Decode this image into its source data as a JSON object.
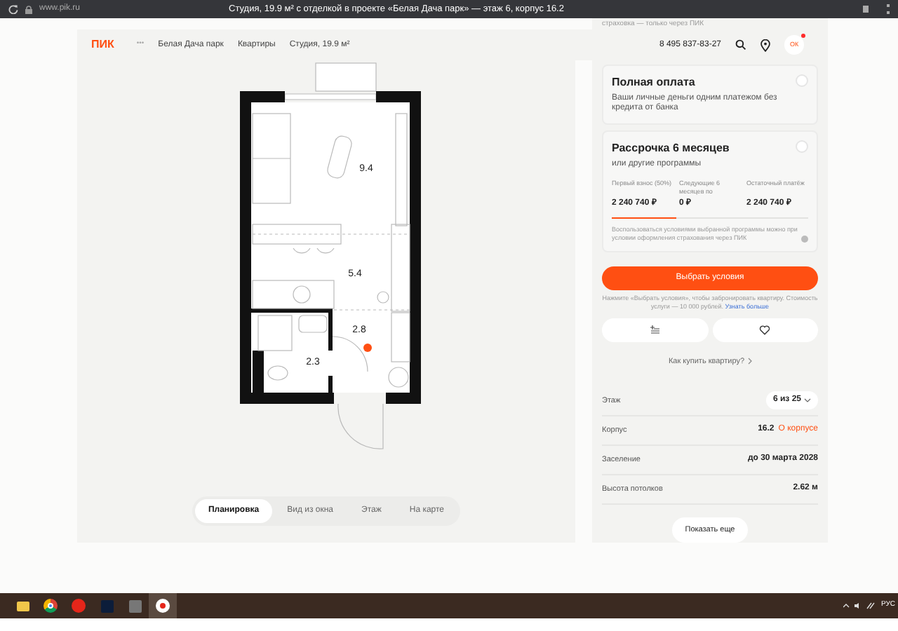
{
  "browser": {
    "url": "www.pik.ru",
    "title": "Студия, 19.9 м² с отделкой в проекте «Белая Дача парк» — этаж 6, корпус 16.2"
  },
  "header": {
    "logo": "ПИК",
    "more": "•••",
    "breadcrumbs": [
      "Белая Дача парк",
      "Квартиры",
      "Студия, 19.9 м²"
    ],
    "phone": "8 495 837-83-27",
    "avatar": "ОК",
    "notification": true
  },
  "plan": {
    "rooms": [
      {
        "area": "9.4"
      },
      {
        "area": "5.4"
      },
      {
        "area": "2.8"
      },
      {
        "area": "2.3"
      }
    ],
    "tabs": [
      {
        "label": "Планировка",
        "selected": true
      },
      {
        "label": "Вид из окна",
        "selected": false
      },
      {
        "label": "Этаж",
        "selected": false
      },
      {
        "label": "На карте",
        "selected": false
      }
    ]
  },
  "panel": {
    "top_note": "страховка — только через ПИК",
    "options": [
      {
        "title": "Полная оплата",
        "text": "Ваши личные деньги одним платежом без кредита от банка",
        "selected": false
      },
      {
        "title": "Рассрочка 6 месяцев",
        "text": "или другие программы",
        "selected": false,
        "columns": [
          {
            "label": "Первый взнос (50%)",
            "value": "2 240 740 ₽"
          },
          {
            "label": "Следующие 6 месяцев по",
            "value": "0 ₽"
          },
          {
            "label": "Остаточный платёж",
            "value": "2 240 740 ₽"
          }
        ],
        "level": 0.33,
        "note": "Воспользоваться условиями выбранной программы можно при условии оформления страхования через ПИК"
      }
    ],
    "primary_button": "Выбрать условия",
    "booking_note": "Нажмите «Выбрать условия», чтобы забронировать квартиру. Стоимость услуги — 10 000 рублей.",
    "booking_link": "Узнать больше",
    "how_to_buy": "Как купить квартиру?",
    "details": [
      {
        "kind": "dropdown",
        "label": "Этаж",
        "value": "6 из 25"
      },
      {
        "kind": "link",
        "label": "Корпус",
        "value": "16.2",
        "link": "О корпусе"
      },
      {
        "kind": "plain",
        "label": "Заселение",
        "value": "до 30 марта 2028"
      },
      {
        "kind": "plain",
        "label": "Высота потолков",
        "value": "2.62 м"
      }
    ],
    "more_button": "Показать еще"
  },
  "taskbar": {
    "apps": [
      {
        "kind": "folder",
        "selected": false
      },
      {
        "kind": "chrome",
        "selected": false
      },
      {
        "kind": "yandex",
        "selected": false
      },
      {
        "kind": "photoshop",
        "selected": false
      },
      {
        "kind": "app",
        "selected": false
      },
      {
        "kind": "yabrowser",
        "selected": true
      }
    ],
    "language": "РУС"
  }
}
